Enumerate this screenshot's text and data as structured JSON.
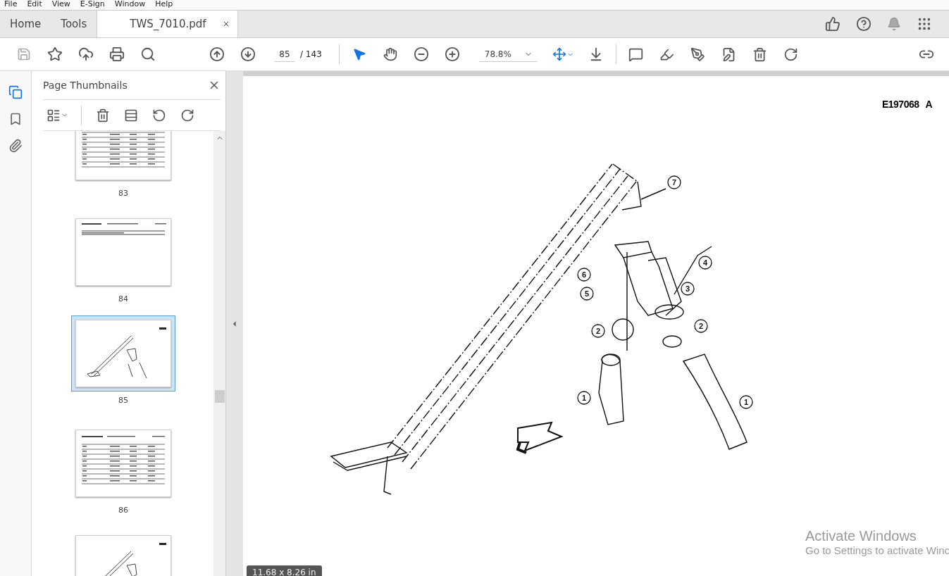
{
  "menu": [
    "File",
    "Edit",
    "View",
    "E-Sign",
    "Window",
    "Help"
  ],
  "tabs": [
    {
      "label": "Home",
      "selected": false,
      "kind": "nav"
    },
    {
      "label": "Tools",
      "selected": false,
      "kind": "nav"
    },
    {
      "label": "TWS_7010.pdf",
      "selected": true,
      "kind": "document"
    }
  ],
  "toolbar": {
    "page_number": "85",
    "page_total": "/ 143",
    "zoom": "78.8%",
    "tools": [
      {
        "kind": "select",
        "selected": true
      },
      {
        "kind": "hand",
        "selected": false
      }
    ]
  },
  "rail": [
    {
      "kind": "pages",
      "selected": true
    },
    {
      "kind": "bookmarks",
      "selected": false
    },
    {
      "kind": "attachments",
      "selected": false
    }
  ],
  "panel": {
    "title": "Page Thumbnails",
    "thumbnails": [
      {
        "label": "83",
        "kind": "table",
        "selected": false
      },
      {
        "label": "84",
        "kind": "header",
        "selected": false
      },
      {
        "label": "85",
        "kind": "drawing",
        "selected": true
      },
      {
        "label": "86",
        "kind": "table",
        "selected": false
      },
      {
        "kind": "drawing",
        "selected": false
      }
    ]
  },
  "document": {
    "drawing_number": "E197068",
    "revision": "A",
    "callouts": [
      "7",
      "4",
      "6",
      "3",
      "5",
      "2",
      "2",
      "1",
      "1"
    ],
    "page_size": "11.68 x 8.26 in"
  },
  "os_notice": {
    "title": "Activate Windows",
    "message": "Go to Settings to activate Winc"
  }
}
